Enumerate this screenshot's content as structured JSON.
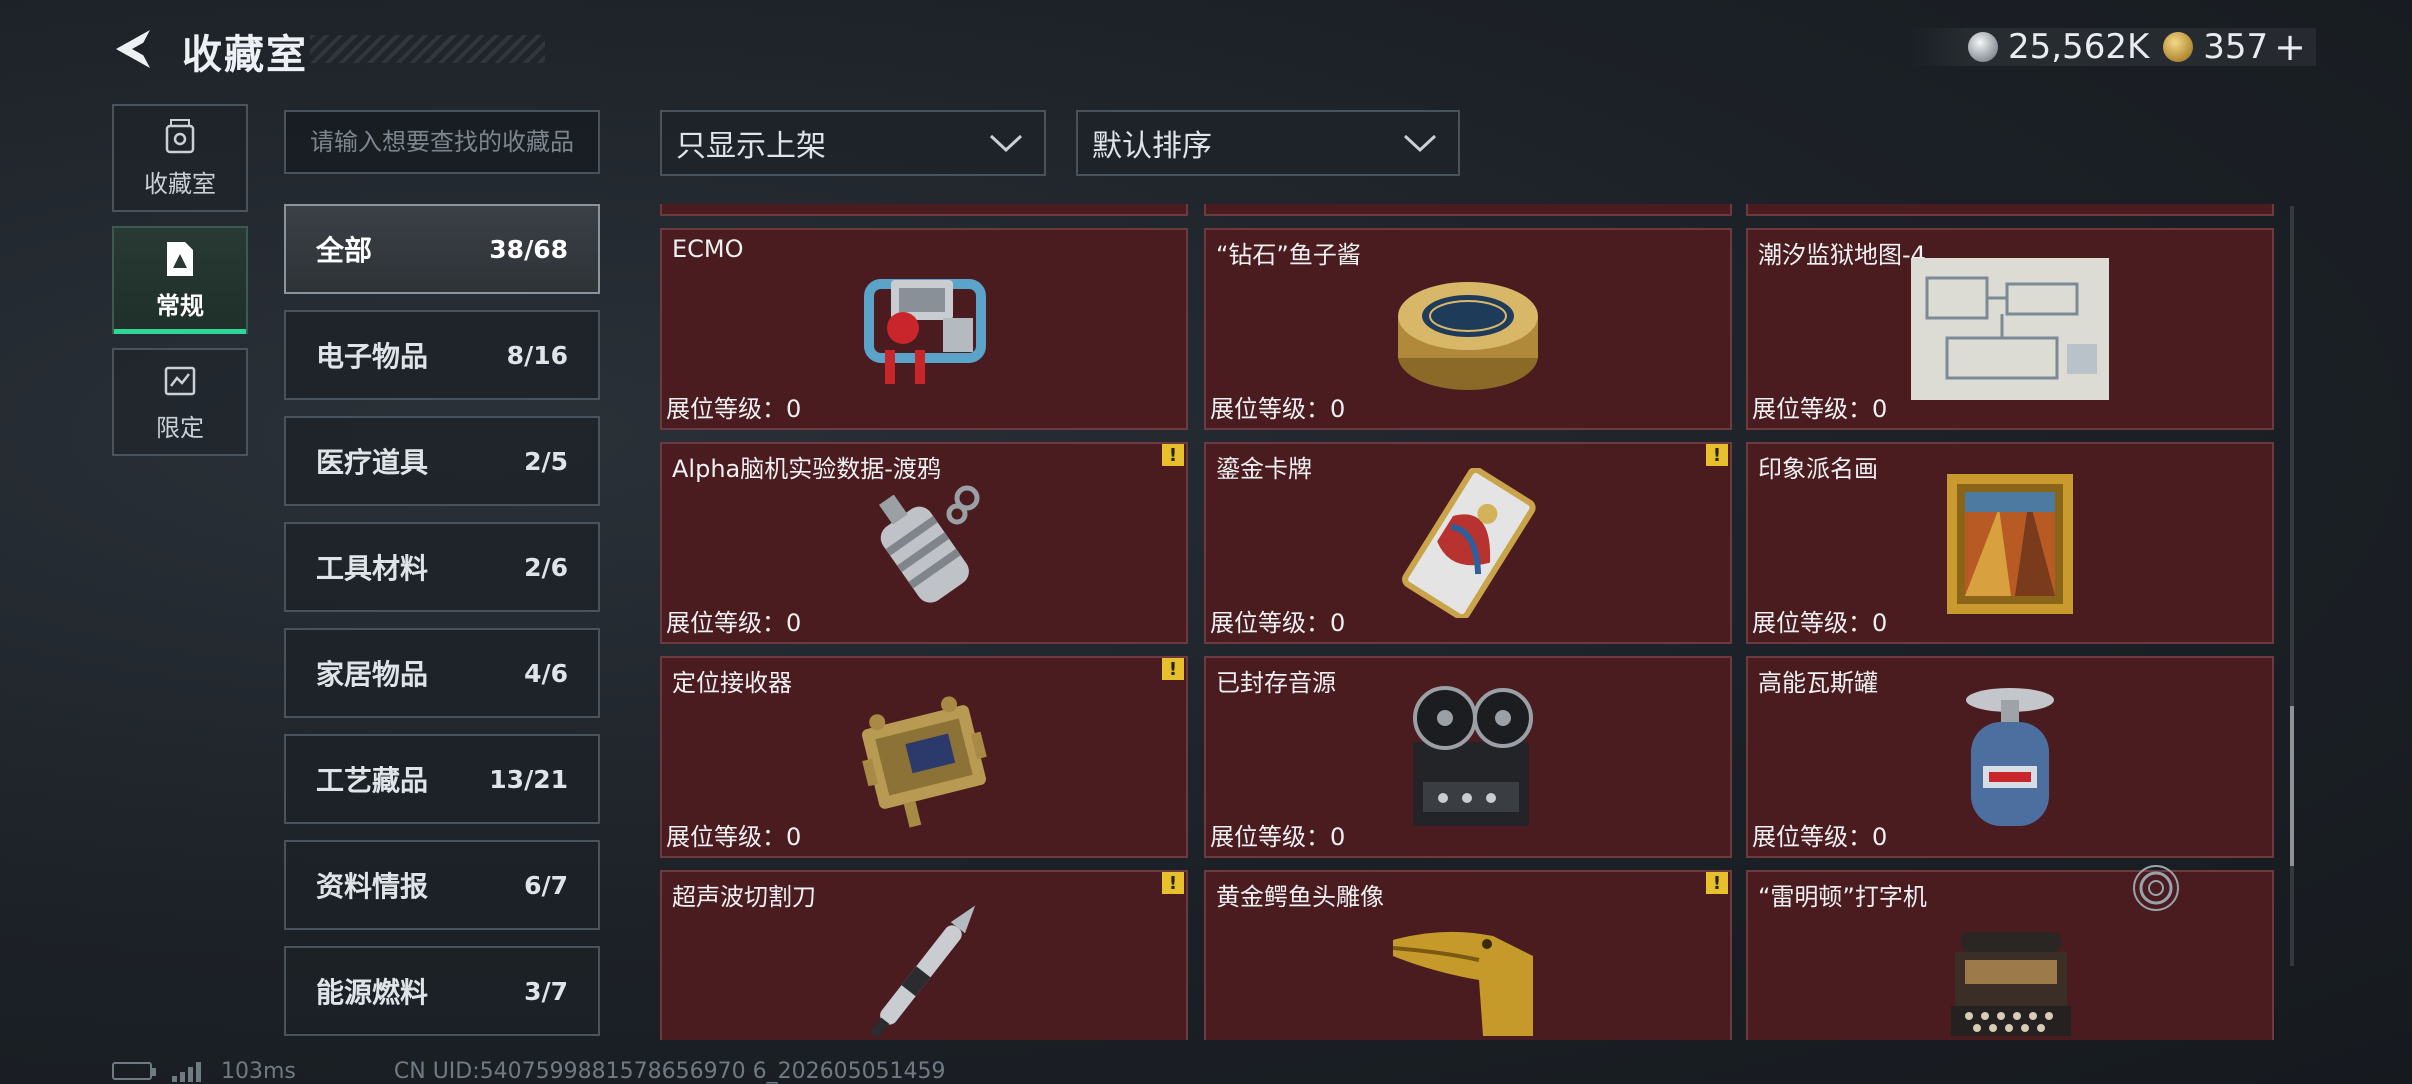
{
  "header": {
    "title": "收藏室",
    "currency_silver": "25,562K",
    "currency_gold": "357",
    "currency_plus": "+",
    "back_icon": "back-arrow-icon"
  },
  "nav": [
    {
      "label": "收藏室",
      "icon": "collection-room-icon",
      "active": false
    },
    {
      "label": "常规",
      "icon": "regular-icon",
      "active": true
    },
    {
      "label": "限定",
      "icon": "limited-icon",
      "active": false
    }
  ],
  "search": {
    "placeholder": "请输入想要查找的收藏品"
  },
  "categories": [
    {
      "name": "全部",
      "count": "38/68",
      "active": true
    },
    {
      "name": "电子物品",
      "count": "8/16"
    },
    {
      "name": "医疗道具",
      "count": "2/5"
    },
    {
      "name": "工具材料",
      "count": "2/6"
    },
    {
      "name": "家居物品",
      "count": "4/6"
    },
    {
      "name": "工艺藏品",
      "count": "13/21"
    },
    {
      "name": "资料情报",
      "count": "6/7"
    },
    {
      "name": "能源燃料",
      "count": "3/7"
    }
  ],
  "filters": {
    "shelf_filter": "只显示上架",
    "sort": "默认排序"
  },
  "items": [
    {
      "name": "ECMO",
      "level": "展位等级：0",
      "icon": "ecmo-machine-icon",
      "warn": false
    },
    {
      "name": "“钻石”鱼子酱",
      "level": "展位等级：0",
      "icon": "caviar-tin-icon",
      "warn": false
    },
    {
      "name": "潮汐监狱地图-4",
      "level": "展位等级：0",
      "icon": "prison-map-icon",
      "warn": false
    },
    {
      "name": "Alpha脑机实验数据-渡鸦",
      "level": "展位等级：0",
      "icon": "data-drive-icon",
      "warn": true
    },
    {
      "name": "鎏金卡牌",
      "level": "展位等级：0",
      "icon": "gilded-card-icon",
      "warn": true
    },
    {
      "name": "印象派名画",
      "level": "展位等级：0",
      "icon": "framed-painting-icon",
      "warn": false
    },
    {
      "name": "定位接收器",
      "level": "展位等级：0",
      "icon": "locator-receiver-icon",
      "warn": true
    },
    {
      "name": "已封存音源",
      "level": "展位等级：0",
      "icon": "reel-recorder-icon",
      "warn": false
    },
    {
      "name": "高能瓦斯罐",
      "level": "展位等级：0",
      "icon": "gas-canister-icon",
      "warn": false
    },
    {
      "name": "超声波切割刀",
      "level": "",
      "icon": "ultrasonic-cutter-icon",
      "warn": true
    },
    {
      "name": "黄金鳄鱼头雕像",
      "level": "",
      "icon": "gold-crocodile-statue-icon",
      "warn": true
    },
    {
      "name": "“雷明顿”打字机",
      "level": "",
      "icon": "typewriter-icon",
      "warn": false
    }
  ],
  "warn_mark": "!",
  "footer": {
    "ping": "103ms",
    "uid": "CN UID:5407599881578656970 6_202605051459"
  },
  "colors": {
    "card_bg": "#4a1c20",
    "card_border": "#6d3a3f",
    "accent_green": "#2fd69a",
    "warn_yellow": "#e6c02d"
  }
}
